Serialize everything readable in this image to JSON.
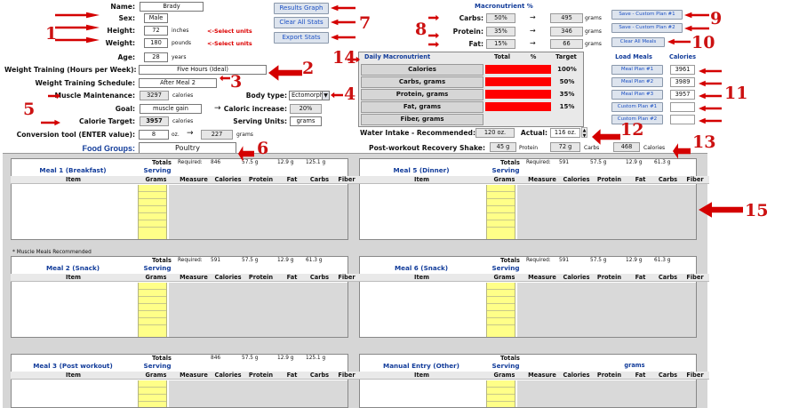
{
  "profile": {
    "name_label": "Name:",
    "name": "Brady",
    "sex_label": "Sex:",
    "sex": "Male",
    "height_label": "Height:",
    "height": "72",
    "height_unit": "inches",
    "weight_label": "Weight:",
    "weight": "180",
    "weight_unit": "pounds",
    "age_label": "Age:",
    "age": "28",
    "age_unit": "years",
    "select_units": "<-Select units"
  },
  "training": {
    "weight_training_label": "Weight Training (Hours per Week):",
    "weight_training": "Five Hours (Ideal)",
    "schedule_label": "Weight Training Schedule:",
    "schedule": "After Meal 2",
    "muscle_label": "Muscle Maintenance:",
    "muscle": "3297",
    "muscle_unit": "calories",
    "goal_label": "Goal:",
    "goal": "muscle gain",
    "calorie_target_label": "Calorie Target:",
    "calorie_target": "3957",
    "calorie_target_unit": "calories",
    "body_type_label": "Body type:",
    "body_type": "Ectomorph",
    "caloric_increase_label": "Caloric increase:",
    "caloric_increase": "20%",
    "serving_units_label": "Serving Units:",
    "serving_units": "grams",
    "conversion_label": "Conversion tool (ENTER value):",
    "conv_in": "8",
    "conv_in_unit": "oz.",
    "conv_arrow": "→",
    "conv_out": "227",
    "conv_out_unit": "grams",
    "food_groups_label": "Food Groups:",
    "food_group": "Poultry"
  },
  "buttons": {
    "results_graph": "Results Graph",
    "clear_all_stats": "Clear All Stats",
    "export_stats": "Export Stats"
  },
  "macro": {
    "title": "Macronutrient %",
    "rows": [
      {
        "label": "Carbs:",
        "pct": "50%",
        "arrow": "→",
        "grams": "495",
        "unit": "grams"
      },
      {
        "label": "Protein:",
        "pct": "35%",
        "arrow": "→",
        "grams": "346",
        "unit": "grams"
      },
      {
        "label": "Fat:",
        "pct": "15%",
        "arrow": "→",
        "grams": "66",
        "unit": "grams"
      }
    ]
  },
  "plans": {
    "save1": "Save - Custom Plan #1",
    "save2": "Save - Custom Plan #2",
    "clear_all_meals": "Clear All Meals",
    "load_header": "Load Meals",
    "cal_header": "Calories",
    "rows": [
      {
        "label": "Meal Plan #1",
        "cal": "3961"
      },
      {
        "label": "Meal Plan #2",
        "cal": "3989"
      },
      {
        "label": "Meal Plan #3",
        "cal": "3957"
      },
      {
        "label": "Custom Plan #1",
        "cal": ""
      },
      {
        "label": "Custom Plan #2",
        "cal": ""
      }
    ]
  },
  "daily": {
    "headers": {
      "name": "Daily Macronutrient",
      "total": "Total",
      "pct": "%",
      "target": "Target"
    },
    "rows": [
      {
        "label": "Calories",
        "target": "100%",
        "fill": 1
      },
      {
        "label": "Carbs, grams",
        "target": "50%",
        "fill": 1
      },
      {
        "label": "Protein, grams",
        "target": "35%",
        "fill": 1
      },
      {
        "label": "Fat, grams",
        "target": "15%",
        "fill": 1
      },
      {
        "label": "Fiber, grams",
        "target": "",
        "fill": 0
      }
    ]
  },
  "water": {
    "label": "Water Intake - Recommended:",
    "recommended": "120 oz.",
    "actual_label": "Actual:",
    "actual": "116 oz."
  },
  "shake": {
    "label": "Post-workout Recovery Shake:",
    "protein": "45 g",
    "protein_unit": "Protein",
    "carbs": "72 g",
    "carbs_unit": "Carbs",
    "cal": "468",
    "cal_unit": "Calories"
  },
  "columns": [
    "Item",
    "Grams",
    "Measure",
    "Calories",
    "Protein",
    "Fat",
    "Carbs",
    "Fiber"
  ],
  "serving": "Serving",
  "totals": "Totals",
  "required": "Required:",
  "muscle_note": "* Muscle Meals Recommended",
  "meals": [
    {
      "title": "Meal 1 (Breakfast)",
      "req": [
        "846",
        "57.5 g",
        "12.9 g",
        "125.1 g"
      ]
    },
    {
      "title": "Meal 5 (Dinner)",
      "req": [
        "591",
        "57.5 g",
        "12.9 g",
        "61.3 g"
      ]
    },
    {
      "title": "Meal 2 (Snack)",
      "req": [
        "591",
        "57.5 g",
        "12.9 g",
        "61.3 g"
      ]
    },
    {
      "title": "Meal 6 (Snack)",
      "req": [
        "591",
        "57.5 g",
        "12.9 g",
        "61.3 g"
      ]
    },
    {
      "title": "Meal 3 (Post workout)",
      "req": [
        "846",
        "57.5 g",
        "12.9 g",
        "125.1 g"
      ]
    },
    {
      "title": "Manual Entry (Other)",
      "req": [
        "",
        "",
        "",
        ""
      ],
      "extra": "grams"
    }
  ],
  "annotations": [
    "1",
    "2",
    "3",
    "4",
    "5",
    "6",
    "7",
    "8",
    "9",
    "10",
    "11",
    "12",
    "13",
    "14",
    "15"
  ],
  "colors": {
    "arrow": "#d40000",
    "link": "#1a4fc4",
    "highlight": "#ffff88",
    "bar": "#ff0000"
  }
}
